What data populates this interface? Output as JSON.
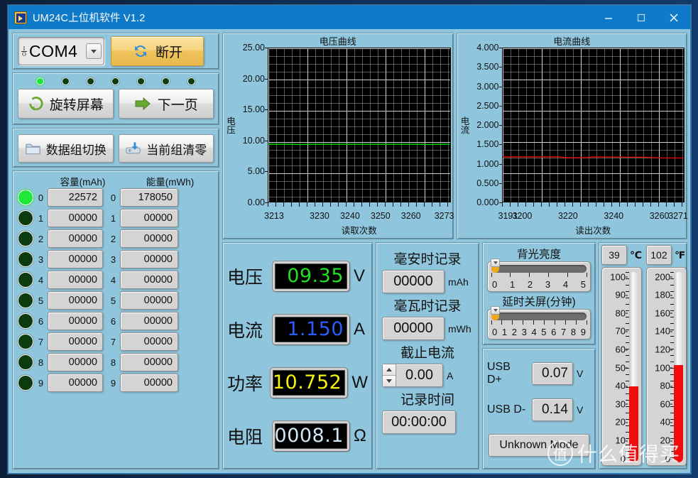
{
  "window": {
    "title": "UM24C上位机软件 V1.2",
    "icon": "labview-icon",
    "minimize": "–",
    "maximize": "□",
    "close": "✕"
  },
  "connection": {
    "port_value": "COM4",
    "port_icon": "io-icon",
    "dropdown_icon": "chevron-down-icon",
    "disconnect_label": "断开",
    "disconnect_icon": "refresh-icon",
    "accent": "#eec25c"
  },
  "leds": {
    "page_indicators": [
      true,
      false,
      false,
      false,
      false,
      false,
      false
    ],
    "rotate_label": "旋转屏幕",
    "rotate_icon": "rotate-arrow-icon",
    "next_page_label": "下一页",
    "next_page_icon": "right-arrow-icon"
  },
  "groups": {
    "switch_label": "数据组切换",
    "switch_icon": "folder-icon",
    "clear_label": "当前组清零",
    "clear_icon": "save-clear-icon"
  },
  "table": {
    "headers": [
      "容量(mAh)",
      "能量(mWh)"
    ],
    "rows": [
      {
        "index": "0",
        "active": true,
        "capacity": "22572",
        "energy": "178050"
      },
      {
        "index": "1",
        "active": false,
        "capacity": "00000",
        "energy": "00000"
      },
      {
        "index": "2",
        "active": false,
        "capacity": "00000",
        "energy": "00000"
      },
      {
        "index": "3",
        "active": false,
        "capacity": "00000",
        "energy": "00000"
      },
      {
        "index": "4",
        "active": false,
        "capacity": "00000",
        "energy": "00000"
      },
      {
        "index": "5",
        "active": false,
        "capacity": "00000",
        "energy": "00000"
      },
      {
        "index": "6",
        "active": false,
        "capacity": "00000",
        "energy": "00000"
      },
      {
        "index": "7",
        "active": false,
        "capacity": "00000",
        "energy": "00000"
      },
      {
        "index": "8",
        "active": false,
        "capacity": "00000",
        "energy": "00000"
      },
      {
        "index": "9",
        "active": false,
        "capacity": "00000",
        "energy": "00000"
      }
    ]
  },
  "chart_data": [
    {
      "type": "line",
      "id": "voltage-chart",
      "title": "电压曲线",
      "xlabel": "读取次数",
      "ylabel": "电压",
      "ylim": [
        0.0,
        25.0
      ],
      "yticks": [
        "0.00",
        "5.00",
        "10.00",
        "15.00",
        "20.00",
        "25.00"
      ],
      "ytick_values": [
        0.0,
        5.0,
        10.0,
        15.0,
        20.0,
        25.0
      ],
      "xlim": [
        3213,
        3273
      ],
      "xticks": [
        "3213",
        "3230",
        "3240",
        "3250",
        "3260",
        "3273"
      ],
      "xtick_values": [
        3213,
        3230,
        3240,
        3250,
        3260,
        3273
      ],
      "grid": true,
      "plot_bg": "#000000",
      "series": [
        {
          "name": "电压",
          "color": "#00d800",
          "x": [
            3213,
            3220,
            3224,
            3228,
            3240,
            3252,
            3262,
            3266,
            3270,
            3273
          ],
          "values": [
            9.36,
            9.36,
            9.33,
            9.36,
            9.36,
            9.36,
            9.36,
            9.32,
            9.36,
            9.35
          ]
        }
      ]
    },
    {
      "type": "line",
      "id": "current-chart",
      "title": "电流曲线",
      "xlabel": "读出次数",
      "ylabel": "电流",
      "ylim": [
        0.0,
        4.0
      ],
      "yticks": [
        "0.000",
        "0.500",
        "1.000",
        "1.500",
        "2.000",
        "2.500",
        "3.000",
        "3.500",
        "4.000"
      ],
      "ytick_values": [
        0.0,
        0.5,
        1.0,
        1.5,
        2.0,
        2.5,
        3.0,
        3.5,
        4.0
      ],
      "xlim": [
        3191,
        3271
      ],
      "xticks": [
        "3191",
        "3200",
        "3220",
        "3240",
        "3260",
        "3271"
      ],
      "xtick_values": [
        3191,
        3200,
        3220,
        3240,
        3260,
        3271
      ],
      "grid": true,
      "plot_bg": "#000000",
      "series": [
        {
          "name": "电流",
          "color": "#e40000",
          "x": [
            3191,
            3205,
            3216,
            3219,
            3228,
            3231,
            3244,
            3253,
            3262,
            3271
          ],
          "values": [
            1.17,
            1.17,
            1.17,
            1.15,
            1.15,
            1.17,
            1.16,
            1.16,
            1.14,
            1.14
          ]
        }
      ]
    }
  ],
  "meters": [
    {
      "label": "电压",
      "value": "09.35",
      "unit": "V",
      "color": "#22e022"
    },
    {
      "label": "电流",
      "value": "1.150",
      "unit": "A",
      "color": "#2b5cff"
    },
    {
      "label": "功率",
      "value": "10.752",
      "unit": "W",
      "color": "#f5f30d"
    },
    {
      "label": "电阻",
      "value": "0008.1",
      "unit": "Ω",
      "color": "#cfe8f5"
    }
  ],
  "record": {
    "mah_label": "毫安时记录",
    "mah_value": "00000",
    "mah_unit": "mAh",
    "mwh_label": "毫瓦时记录",
    "mwh_value": "00000",
    "mwh_unit": "mWh",
    "cutoff_label": "截止电流",
    "cutoff_value": "0.00",
    "cutoff_unit": "A",
    "time_label": "记录时间",
    "time_value": "00:00:00"
  },
  "controls": {
    "backlight_label": "背光亮度",
    "backlight_value": 0,
    "backlight_ticks": [
      "0",
      "1",
      "2",
      "3",
      "4",
      "5"
    ],
    "sleep_label": "延时关屏(分钟)",
    "sleep_value": 0,
    "sleep_ticks": [
      "0",
      "1",
      "2",
      "3",
      "4",
      "5",
      "6",
      "7",
      "8",
      "9"
    ],
    "usb_dp_label": "USB D+",
    "usb_dp_value": "0.07",
    "usb_dp_unit": "V",
    "usb_dn_label": "USB D-",
    "usb_dn_value": "0.14",
    "usb_dn_unit": "V",
    "mode_value": "Unknown Mode"
  },
  "temperature": {
    "celsius_value": "39",
    "celsius_unit": "℃",
    "fahrenheit_value": "102",
    "fahrenheit_unit": "℉",
    "celsius_scale": [
      "100",
      "90",
      "80",
      "70",
      "60",
      "50",
      "40",
      "30",
      "20",
      "10",
      "0"
    ],
    "fahrenheit_scale": [
      "200",
      "180",
      "160",
      "140",
      "120",
      "100",
      "80",
      "60",
      "40",
      "20",
      "0"
    ],
    "celsius_max": 100,
    "fahrenheit_max": 200,
    "fill_color": "#ef0c0c"
  },
  "watermark": {
    "logo": "值",
    "text": "什么值得买"
  }
}
